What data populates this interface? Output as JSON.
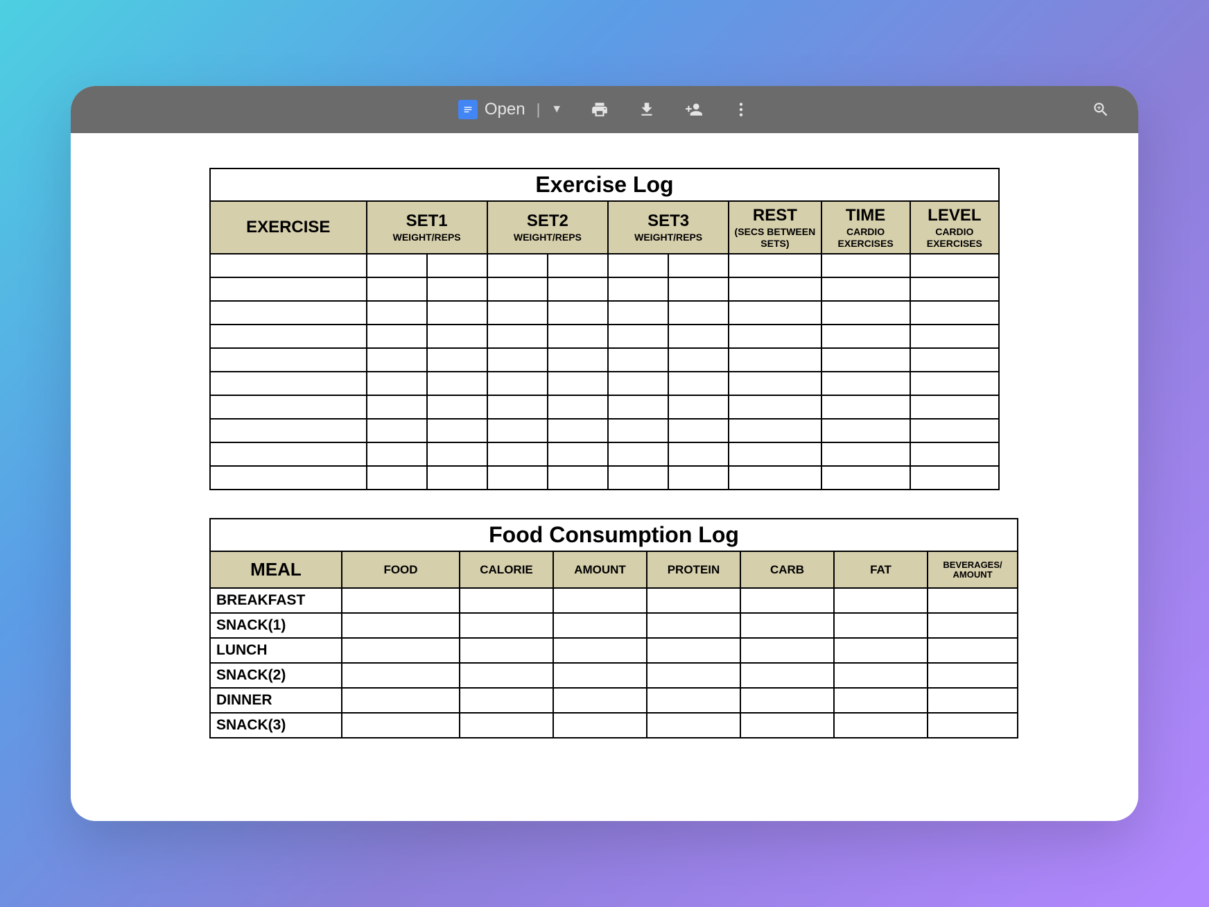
{
  "toolbar": {
    "open_label": "Open"
  },
  "exercise_log": {
    "title": "Exercise Log",
    "headers": {
      "exercise": "EXERCISE",
      "set1": "SET1",
      "set1_sub": "WEIGHT/REPS",
      "set2": "SET2",
      "set2_sub": "WEIGHT/REPS",
      "set3": "SET3",
      "set3_sub": "WEIGHT/REPS",
      "rest": "REST",
      "rest_sub": "(SECS BETWEEN SETS)",
      "time": "TIME",
      "time_sub": "CARDIO EXERCISES",
      "level": "LEVEL",
      "level_sub": "CARDIO EXERCISES"
    },
    "row_count": 10
  },
  "food_log": {
    "title": "Food Consumption Log",
    "headers": {
      "meal": "MEAL",
      "food": "FOOD",
      "calorie": "CALORIE",
      "amount": "AMOUNT",
      "protein": "PROTEIN",
      "carb": "CARB",
      "fat": "FAT",
      "beverages": "BEVERAGES/ AMOUNT"
    },
    "rows": [
      "BREAKFAST",
      "SNACK(1)",
      "LUNCH",
      "SNACK(2)",
      "DINNER",
      "SNACK(3)"
    ]
  }
}
